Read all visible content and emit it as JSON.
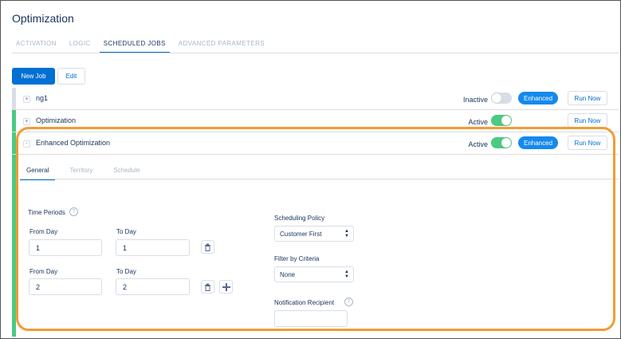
{
  "title": "Optimization",
  "tabs": [
    {
      "label": "ACTIVATION",
      "active": false
    },
    {
      "label": "LOGIC",
      "active": false
    },
    {
      "label": "SCHEDULED JOBS",
      "active": true
    },
    {
      "label": "ADVANCED PARAMETERS",
      "active": false
    }
  ],
  "toolbar": {
    "new_job": "New Job",
    "edit": "Edit"
  },
  "jobs": [
    {
      "expander": "+",
      "name": "ng1",
      "status": "Inactive",
      "toggle": "off",
      "badge": "Enhanced",
      "run": "Run Now",
      "bar_color": "#d8dde6"
    },
    {
      "expander": "+",
      "name": "Optimization",
      "status": "Active",
      "toggle": "on",
      "badge": "",
      "run": "Run Now",
      "bar_color": "#4bca81"
    },
    {
      "expander": "-",
      "name": "Enhanced Optimization",
      "status": "Active",
      "toggle": "on",
      "badge": "Enhanced",
      "run": "Run Now",
      "bar_color": "#4bca81"
    }
  ],
  "sub_tabs": [
    {
      "label": "General",
      "active": true
    },
    {
      "label": "Territory",
      "active": false
    },
    {
      "label": "Schedule",
      "active": false
    }
  ],
  "time_periods": {
    "label": "Time Periods",
    "help": "?",
    "rows": [
      {
        "from_label": "From Day",
        "from_value": "1",
        "to_label": "To Day",
        "to_value": "1"
      },
      {
        "from_label": "From Day",
        "from_value": "2",
        "to_label": "To Day",
        "to_value": "2"
      }
    ]
  },
  "scheduling_policy": {
    "label": "Scheduling Policy",
    "value": "Customer First"
  },
  "filter": {
    "label": "Filter by Criteria",
    "value": "None"
  },
  "notification": {
    "label": "Notification Recipient",
    "help": "?",
    "value": ""
  },
  "icons": {
    "expander": "expander-icon",
    "delete": "trash-icon",
    "add": "plus-icon",
    "help": "help-icon"
  },
  "colors": {
    "accent": "#0070d2",
    "badge": "#1589ee",
    "active_green": "#4bca81",
    "highlight": "#f29b34"
  }
}
